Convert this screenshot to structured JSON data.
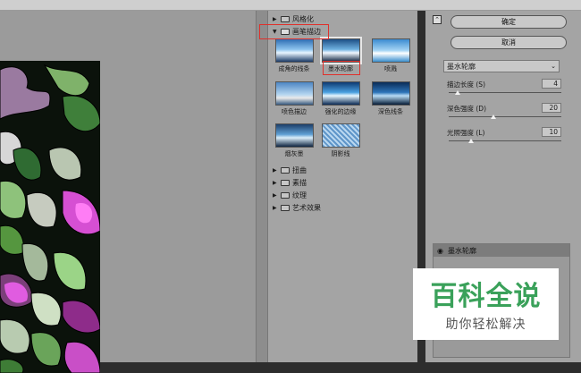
{
  "filters": {
    "categories_top": [
      {
        "label": "风格化",
        "state": "collapsed"
      },
      {
        "label": "画笔描边",
        "state": "expanded"
      }
    ],
    "thumbnails": [
      {
        "label": "成角的线条",
        "selected": false
      },
      {
        "label": "墨水轮廓",
        "selected": true
      },
      {
        "label": "喷溅",
        "selected": false
      },
      {
        "label": "喷色描边",
        "selected": false
      },
      {
        "label": "强化的边缘",
        "selected": false
      },
      {
        "label": "深色线条",
        "selected": false
      },
      {
        "label": "烟灰墨",
        "selected": false
      },
      {
        "label": "阴影线",
        "selected": false
      }
    ],
    "categories_bottom": [
      {
        "label": "扭曲",
        "state": "collapsed"
      },
      {
        "label": "素描",
        "state": "collapsed"
      },
      {
        "label": "纹理",
        "state": "collapsed"
      },
      {
        "label": "艺术效果",
        "state": "collapsed"
      }
    ]
  },
  "settings": {
    "ok_label": "确定",
    "cancel_label": "取消",
    "filter_select": "墨水轮廓",
    "sliders": [
      {
        "label": "描边长度 (S)",
        "value": "4",
        "fraction": 0.08
      },
      {
        "label": "深色强度 (D)",
        "value": "20",
        "fraction": 0.4
      },
      {
        "label": "光照强度 (L)",
        "value": "10",
        "fraction": 0.2
      }
    ]
  },
  "layers": {
    "effect_label": "墨水轮廓"
  },
  "watermark": {
    "title": "百科全说",
    "subtitle": "助你轻松解决"
  },
  "colors": {
    "highlight": "#e0302b",
    "panel": "#a4a4a4",
    "watermark_green": "#3aa15a"
  }
}
